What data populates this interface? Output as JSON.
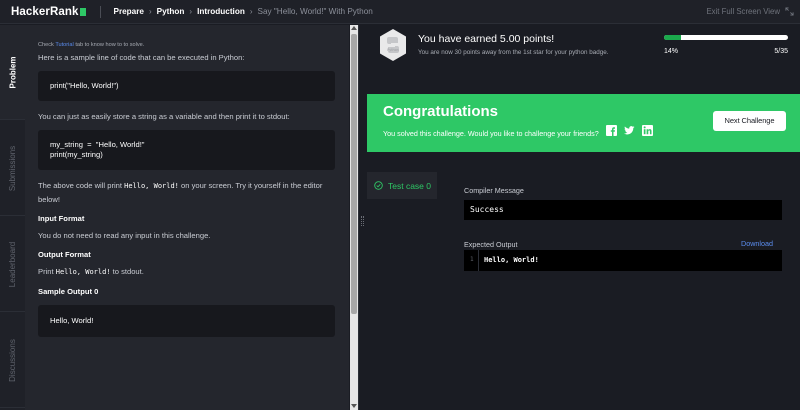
{
  "header": {
    "logo": "HackerRank",
    "breadcrumbs": [
      "Prepare",
      "Python",
      "Introduction",
      "Say \"Hello, World!\" With Python"
    ],
    "fullscreen": "Exit Full Screen View"
  },
  "tabs": [
    "Problem",
    "Submissions",
    "Leaderboard",
    "Discussions"
  ],
  "problem": {
    "hint_pre": "Check ",
    "hint_link": "Tutorial",
    "hint_post": " tab to know how to to solve.",
    "p1": "Here is a sample line of code that can be executed in Python:",
    "code1": "print(\"Hello, World!\")",
    "p2": "You can just as easily store a string as a variable and then print it to stdout:",
    "code2": "my_string  =  \"Hello, World!\"\nprint(my_string)",
    "p3_pre": "The above code will print ",
    "p3_code": "Hello, World!",
    "p3_post": " on your screen. Try it yourself in the editor below!",
    "input_heading": "Input Format",
    "input_text": "You do not need to read any input in this challenge.",
    "output_heading": "Output Format",
    "output_pre": "Print ",
    "output_code": "Hello, World!",
    "output_post": " to stdout.",
    "sample_heading": "Sample Output 0",
    "sample_output": "Hello, World!"
  },
  "points": {
    "badge_label": "Python",
    "title": "You have earned 5.00 points!",
    "subtitle": "You are now 30 points away from the 1st star for your python badge.",
    "progress_percent": 14,
    "progress_label": "14%",
    "progress_count": "5/35"
  },
  "congrats": {
    "title": "Congratulations",
    "subtitle": "You solved this challenge. Would you like to challenge your friends?",
    "next_button": "Next Challenge"
  },
  "result": {
    "test_case": "Test case 0",
    "compiler_label": "Compiler Message",
    "compiler_message": "Success",
    "expected_label": "Expected Output",
    "download": "Download",
    "line_number": "1",
    "expected_output": "Hello, World!"
  },
  "colors": {
    "accent_green": "#2ec866",
    "link_blue": "#5b8def",
    "background": "#1a1c23",
    "panel": "#24262d"
  }
}
